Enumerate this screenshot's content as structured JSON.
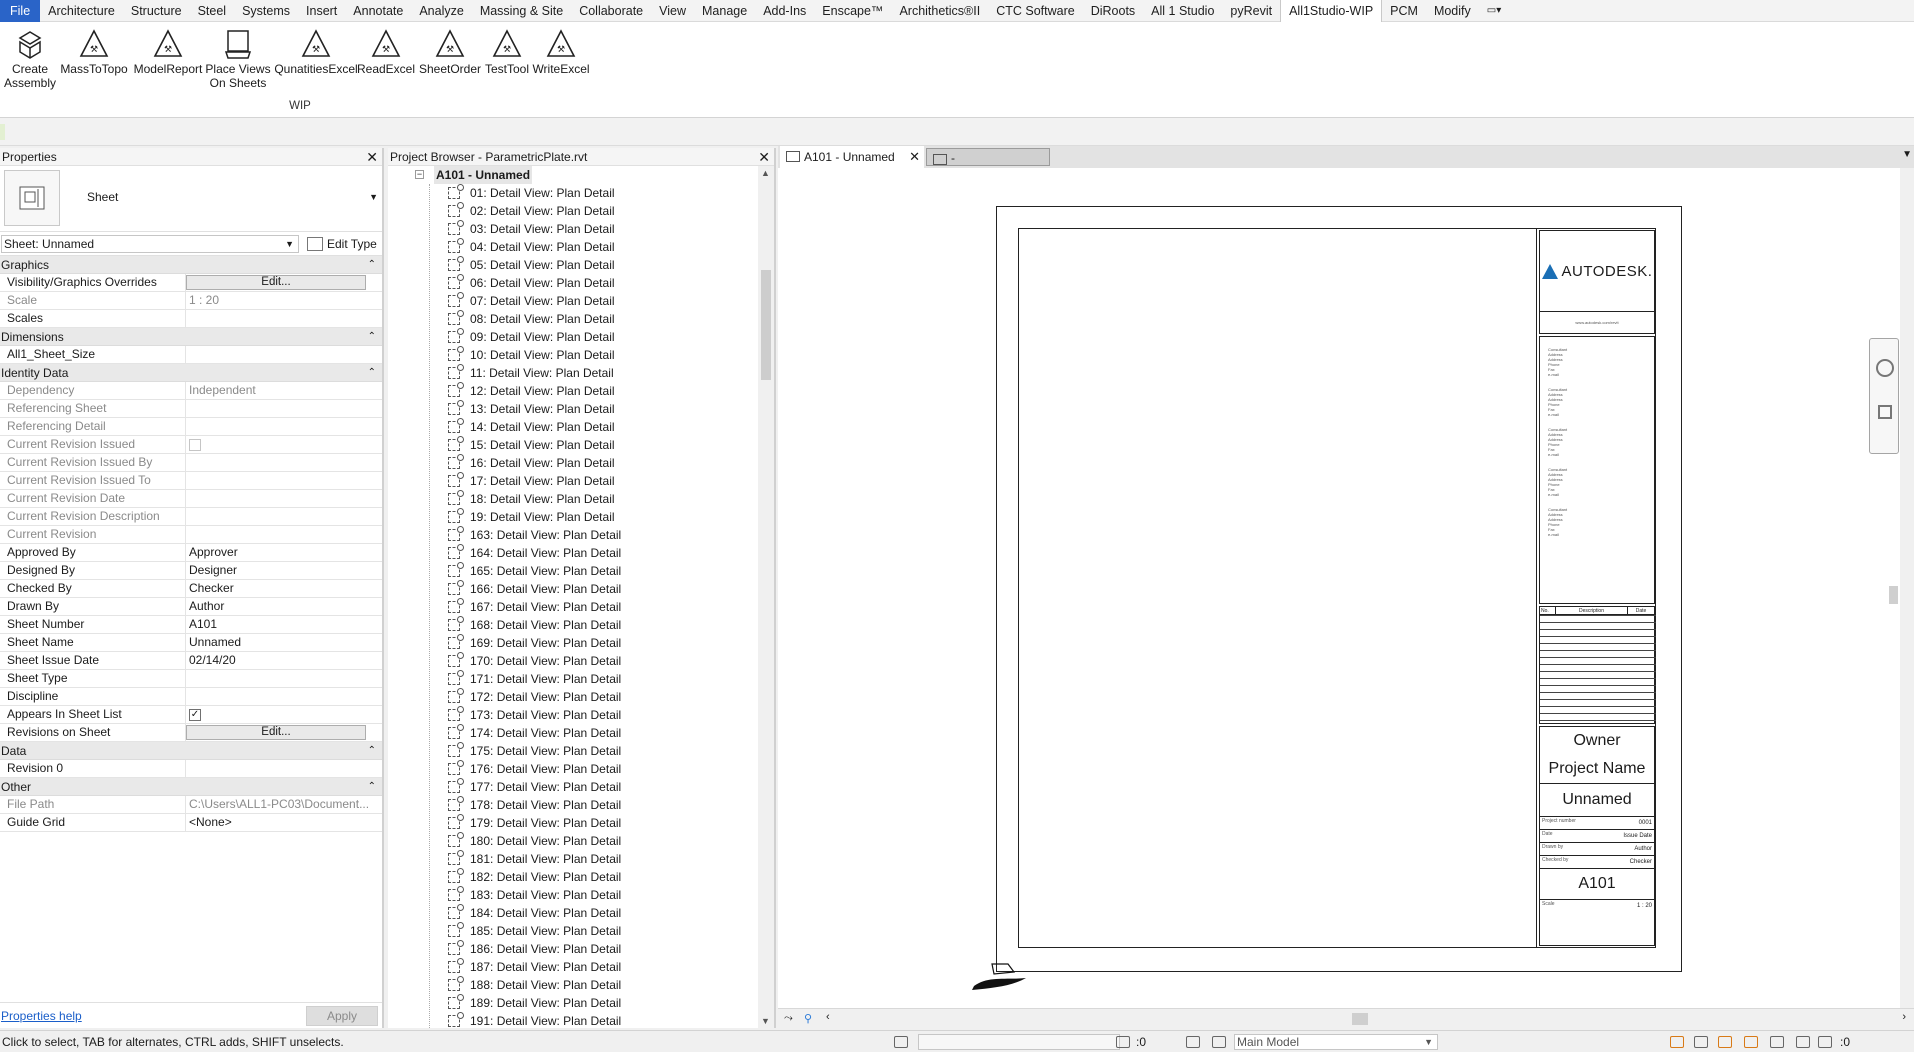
{
  "ribbon_tabs": [
    "File",
    "Architecture",
    "Structure",
    "Steel",
    "Systems",
    "Insert",
    "Annotate",
    "Analyze",
    "Massing & Site",
    "Collaborate",
    "View",
    "Manage",
    "Add-Ins",
    "Enscape™",
    "Archithetics®II",
    "CTC Software",
    "DiRoots",
    "All 1 Studio",
    "pyRevit",
    "All1Studio-WIP",
    "PCM",
    "Modify"
  ],
  "active_tab": "All1Studio-WIP",
  "ribbon_buttons": [
    {
      "label": "Create Assembly",
      "icon": "assembly-icon"
    },
    {
      "label": "MassToTopo",
      "icon": "tool-icon"
    },
    {
      "label": "ModelReport",
      "icon": "tool-icon"
    },
    {
      "label": "Place Views On Sheets",
      "icon": "place-views-icon"
    },
    {
      "label": "QunatitiesExcel",
      "icon": "tool-icon"
    },
    {
      "label": "ReadExcel",
      "icon": "tool-icon"
    },
    {
      "label": "SheetOrder",
      "icon": "tool-icon"
    },
    {
      "label": "TestTool",
      "icon": "tool-icon"
    },
    {
      "label": "WriteExcel",
      "icon": "tool-icon"
    }
  ],
  "ribbon_panel_label": "WIP",
  "properties": {
    "title": "Properties",
    "type_name": "Sheet",
    "instance_selector": "Sheet: Unnamed",
    "edit_type": "Edit Type",
    "categories": [
      {
        "name": "Graphics",
        "rows": [
          {
            "k": "Visibility/Graphics Overrides",
            "v": "Edit...",
            "kind": "button"
          },
          {
            "k": "Scale",
            "v": "1 : 20",
            "dim": true
          },
          {
            "k": "Scales",
            "v": ""
          }
        ]
      },
      {
        "name": "Dimensions",
        "rows": [
          {
            "k": "All1_Sheet_Size",
            "v": ""
          }
        ]
      },
      {
        "name": "Identity Data",
        "rows": [
          {
            "k": "Dependency",
            "v": "Independent",
            "dim": true
          },
          {
            "k": "Referencing Sheet",
            "v": "",
            "dim": true
          },
          {
            "k": "Referencing Detail",
            "v": "",
            "dim": true
          },
          {
            "k": "Current Revision Issued",
            "v": "",
            "kind": "checkbox-disabled",
            "dim": true
          },
          {
            "k": "Current Revision Issued By",
            "v": "",
            "dim": true
          },
          {
            "k": "Current Revision Issued To",
            "v": "",
            "dim": true
          },
          {
            "k": "Current Revision Date",
            "v": "",
            "dim": true
          },
          {
            "k": "Current Revision Description",
            "v": "",
            "dim": true
          },
          {
            "k": "Current Revision",
            "v": "",
            "dim": true
          },
          {
            "k": "Approved By",
            "v": "Approver"
          },
          {
            "k": "Designed By",
            "v": "Designer"
          },
          {
            "k": "Checked By",
            "v": "Checker"
          },
          {
            "k": "Drawn By",
            "v": "Author"
          },
          {
            "k": "Sheet Number",
            "v": "A101"
          },
          {
            "k": "Sheet Name",
            "v": "Unnamed"
          },
          {
            "k": "Sheet Issue Date",
            "v": "02/14/20"
          },
          {
            "k": "Sheet Type",
            "v": ""
          },
          {
            "k": "Discipline",
            "v": ""
          },
          {
            "k": "Appears In Sheet List",
            "v": "✓",
            "kind": "checkbox"
          },
          {
            "k": "Revisions on Sheet",
            "v": "Edit...",
            "kind": "button"
          }
        ]
      },
      {
        "name": "Data",
        "rows": [
          {
            "k": "Revision 0",
            "v": ""
          }
        ]
      },
      {
        "name": "Other",
        "rows": [
          {
            "k": "File Path",
            "v": "C:\\Users\\ALL1-PC03\\Document...",
            "dim": true
          },
          {
            "k": "Guide Grid",
            "v": "<None>"
          }
        ]
      }
    ],
    "help_link": "Properties help",
    "apply": "Apply"
  },
  "browser": {
    "title": "Project Browser - ParametricPlate.rvt",
    "root": "A101 - Unnamed",
    "items": [
      "01: Detail View: Plan Detail",
      "02: Detail View: Plan Detail",
      "03: Detail View: Plan Detail",
      "04: Detail View: Plan Detail",
      "05: Detail View: Plan Detail",
      "06: Detail View: Plan Detail",
      "07: Detail View: Plan Detail",
      "08: Detail View: Plan Detail",
      "09: Detail View: Plan Detail",
      "10: Detail View: Plan Detail",
      "11: Detail View: Plan Detail",
      "12: Detail View: Plan Detail",
      "13: Detail View: Plan Detail",
      "14: Detail View: Plan Detail",
      "15: Detail View: Plan Detail",
      "16: Detail View: Plan Detail",
      "17: Detail View: Plan Detail",
      "18: Detail View: Plan Detail",
      "19: Detail View: Plan Detail",
      "163: Detail View: Plan Detail",
      "164: Detail View: Plan Detail",
      "165: Detail View: Plan Detail",
      "166: Detail View: Plan Detail",
      "167: Detail View: Plan Detail",
      "168: Detail View: Plan Detail",
      "169: Detail View: Plan Detail",
      "170: Detail View: Plan Detail",
      "171: Detail View: Plan Detail",
      "172: Detail View: Plan Detail",
      "173: Detail View: Plan Detail",
      "174: Detail View: Plan Detail",
      "175: Detail View: Plan Detail",
      "176: Detail View: Plan Detail",
      "177: Detail View: Plan Detail",
      "178: Detail View: Plan Detail",
      "179: Detail View: Plan Detail",
      "180: Detail View: Plan Detail",
      "181: Detail View: Plan Detail",
      "182: Detail View: Plan Detail",
      "183: Detail View: Plan Detail",
      "184: Detail View: Plan Detail",
      "185: Detail View: Plan Detail",
      "186: Detail View: Plan Detail",
      "187: Detail View: Plan Detail",
      "188: Detail View: Plan Detail",
      "189: Detail View: Plan Detail",
      "191: Detail View: Plan Detail"
    ]
  },
  "view_tabs": {
    "active": "A101 - Unnamed",
    "inactive": "-"
  },
  "titleblock": {
    "logo": "AUTODESK.",
    "website": "www.autodesk.com/revit",
    "consultant_lines": [
      "Consultant",
      "Address",
      "Address",
      "Phone",
      "Fax",
      "e-mail"
    ],
    "rev_headers": [
      "No.",
      "Description",
      "Date"
    ],
    "owner": "Owner",
    "project_name": "Project Name",
    "sheet_name": "Unnamed",
    "fields": [
      {
        "l": "Project number",
        "r": "0001"
      },
      {
        "l": "Date",
        "r": "Issue Date"
      },
      {
        "l": "Drawn by",
        "r": "Author"
      },
      {
        "l": "Checked by",
        "r": "Checker"
      }
    ],
    "sheet_number": "A101",
    "scale_label": "Scale",
    "scale": "1 : 20"
  },
  "status": {
    "message": "Click to select, TAB for alternates, CTRL adds, SHIFT unselects.",
    "zero": ":0",
    "model": "Main Model",
    "filter": ":0"
  }
}
